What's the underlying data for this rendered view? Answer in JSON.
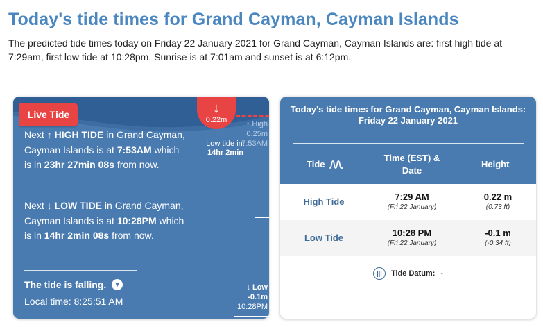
{
  "page": {
    "title": "Today's tide times for Grand Cayman, Cayman Islands",
    "intro": "The predicted tide times today on Friday 22 January 2021 for Grand Cayman, Cayman Islands are: first high tide at 7:29am, first low tide at 10:28pm. Sunrise is at 7:01am and sunset is at 6:12pm."
  },
  "live": {
    "badge": "Live Tide",
    "current_height": "0.22m",
    "next_high": {
      "pre": "Next",
      "arrow": "↑",
      "label": "HIGH TIDE",
      "mid": "in Grand Cayman, Cayman Islands is at",
      "time": "7:53AM",
      "which": "which is in",
      "countdown": "23hr 27min 08s",
      "post": "from now."
    },
    "next_low": {
      "pre": "Next",
      "arrow": "↓",
      "label": "LOW TIDE",
      "mid": "in Grand Cayman, Cayman Islands is at",
      "time": "10:28PM",
      "which": "which is in",
      "countdown": "14hr 2min 08s",
      "post": "from now."
    },
    "chart_high": {
      "label": "↑ High",
      "height": "0.25m",
      "time": "7:53AM"
    },
    "chart_low": {
      "label": "↓ Low",
      "height": "-0.1m",
      "time": "10:28PM"
    },
    "low_tide_in_label": "Low tide in:",
    "low_tide_in_value": "14hr 2min",
    "falling": "The tide is falling.",
    "local_time_label": "Local time:",
    "local_time": "8:25:51 AM"
  },
  "table": {
    "title": "Today's tide times for Grand Cayman, Cayman Islands:",
    "date": "Friday 22 January 2021",
    "headers": {
      "tide": "Tide",
      "time": "Time (EST) & Date",
      "height": "Height"
    },
    "rows": [
      {
        "type": "High Tide",
        "time": "7:29 AM",
        "date": "(Fri 22 January)",
        "height": "0.22 m",
        "height_ft": "(0.73 ft)"
      },
      {
        "type": "Low Tide",
        "time": "10:28 PM",
        "date": "(Fri 22 January)",
        "height": "-0.1 m",
        "height_ft": "(-0.34 ft)"
      }
    ],
    "datum_label": "Tide Datum:",
    "datum_value": "-"
  },
  "colors": {
    "accent": "#4a7bb0",
    "title": "#4a86c0",
    "alert": "#e94444"
  }
}
